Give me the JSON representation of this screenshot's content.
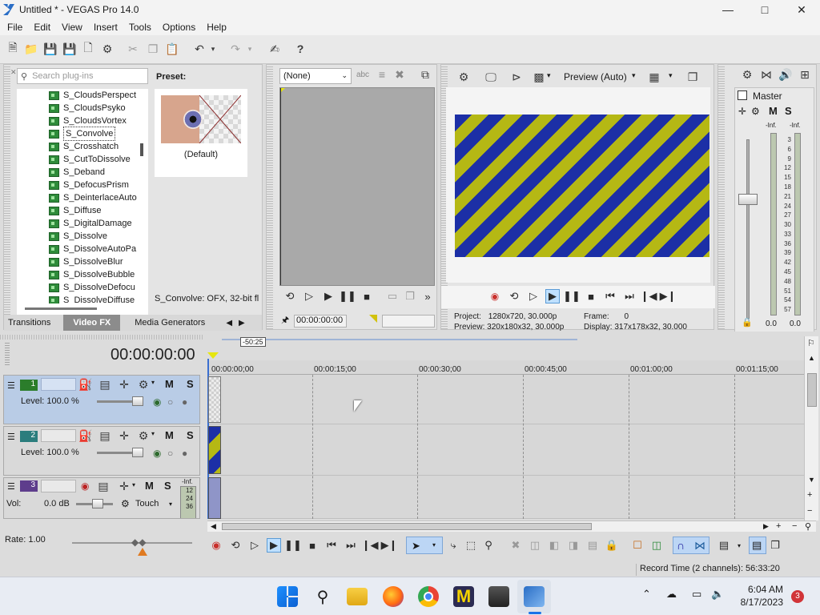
{
  "window": {
    "title": "Untitled * - VEGAS Pro 14.0",
    "minimize_icon": "minimize-icon",
    "maximize_icon": "maximize-icon",
    "close_icon": "close-icon"
  },
  "menu": [
    "File",
    "Edit",
    "View",
    "Insert",
    "Tools",
    "Options",
    "Help"
  ],
  "explorer": {
    "search_placeholder": "Search plug-ins",
    "preset_label": "Preset:",
    "preset_default": "(Default)",
    "plugins": [
      "S_CloudsPerspect",
      "S_CloudsPsyko",
      "S_CloudsVortex",
      "S_Convolve",
      "S_Crosshatch",
      "S_CutToDissolve",
      "S_Deband",
      "S_DefocusPrism",
      "S_DeinterlaceAuto",
      "S_Diffuse",
      "S_DigitalDamage",
      "S_Dissolve",
      "S_DissolveAutoPa",
      "S_DissolveBlur",
      "S_DissolveBubble",
      "S_DissolveDefocu",
      "S_DissolveDiffuse"
    ],
    "selected_plugin": "S_Convolve",
    "plugin_status": "S_Convolve: OFX, 32-bit fl",
    "tabs": [
      "Transitions",
      "Video FX",
      "Media Generators"
    ],
    "active_tab": "Video FX"
  },
  "trimmer": {
    "dropdown_value": "(None)",
    "timecode": "00:00:00:00"
  },
  "preview": {
    "mode": "Preview (Auto)",
    "project_label": "Project:",
    "project_value": "1280x720, 30.000p",
    "preview_label": "Preview:",
    "preview_value": "320x180x32, 30.000p",
    "frame_label": "Frame:",
    "frame_value": "0",
    "display_label": "Display:",
    "display_value": "317x178x32, 30.000",
    "colors": {
      "stripe_blue": "#1c2fa6",
      "stripe_yellow": "#b5b814"
    }
  },
  "master": {
    "title": "Master",
    "m_label": "M",
    "s_label": "S",
    "inf_left": "-Inf.",
    "inf_right": "-Inf.",
    "scale": [
      "3",
      "6",
      "9",
      "12",
      "15",
      "18",
      "21",
      "24",
      "27",
      "30",
      "33",
      "36",
      "39",
      "42",
      "45",
      "48",
      "51",
      "54",
      "57"
    ],
    "bottom_left": "0.0",
    "bottom_right": "0.0"
  },
  "timeline": {
    "timecode": "00:00:00:00",
    "marker_label": "-50:25",
    "ruler": [
      "00:00:00;00",
      "00:00:15;00",
      "00:00:30;00",
      "00:00:45;00",
      "00:01:00;00",
      "00:01:15;00"
    ],
    "tracks": [
      {
        "number": "1",
        "level_label": "Level: 100.0 %",
        "m": "M",
        "s": "S"
      },
      {
        "number": "2",
        "level_label": "Level: 100.0 %",
        "m": "M",
        "s": "S"
      },
      {
        "number": "3",
        "vol_label": "Vol:",
        "vol_value": "0.0 dB",
        "mode": "Touch",
        "m": "M",
        "s": "S",
        "inf": "-Inf.",
        "meter": [
          "12",
          "24",
          "36"
        ]
      }
    ],
    "rate_label": "Rate: 1.00",
    "record_time": "Record Time (2 channels): 56:33:20"
  },
  "taskbar": {
    "time": "6:04 AM",
    "date": "8/17/2023",
    "notification_count": "3"
  }
}
